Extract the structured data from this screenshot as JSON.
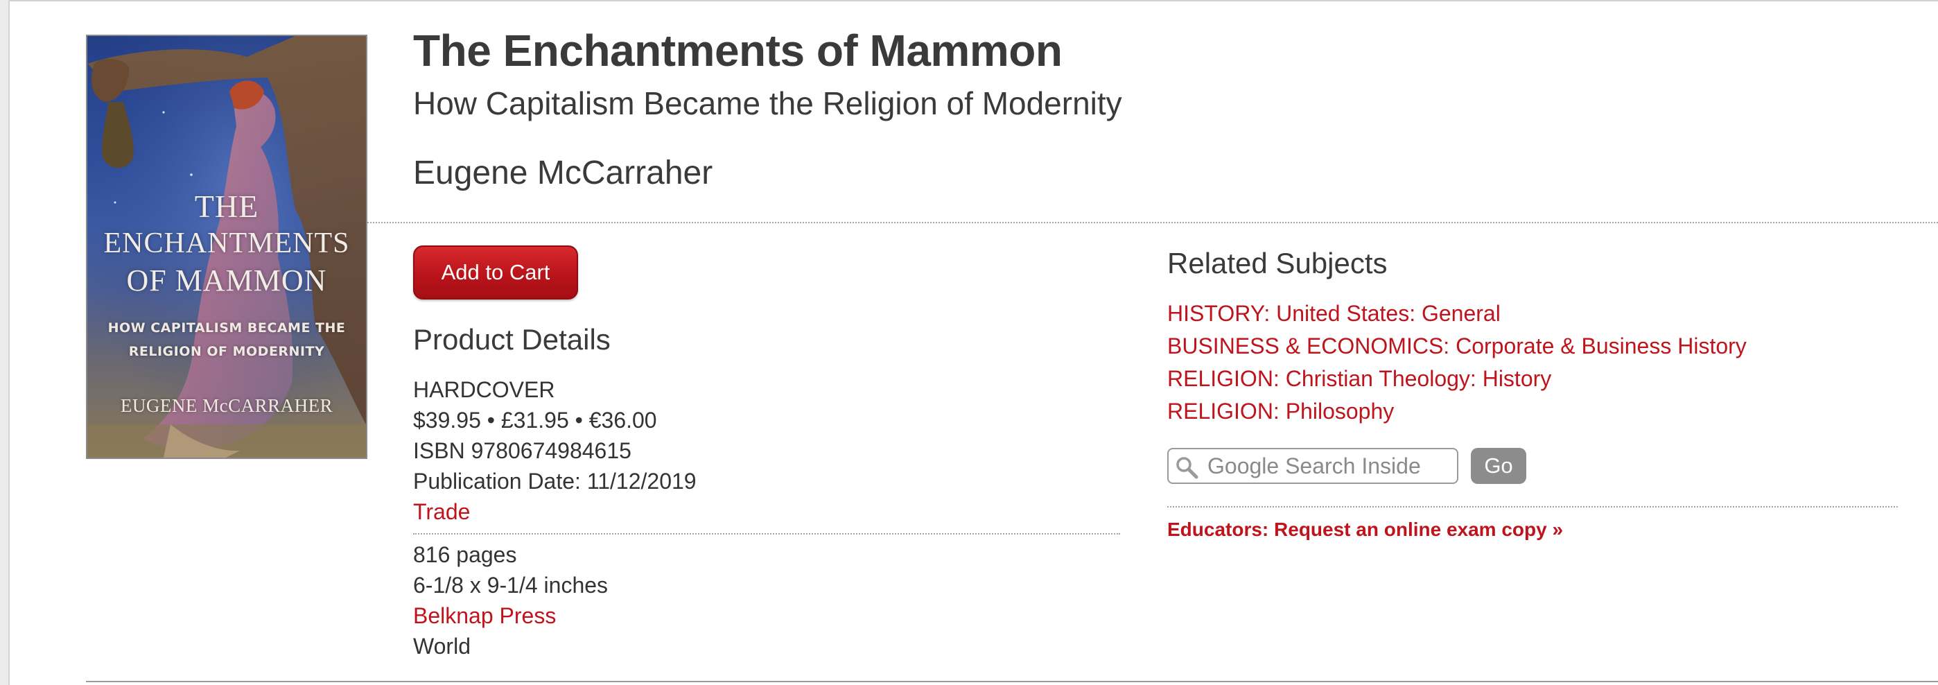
{
  "book": {
    "title": "The Enchantments of Mammon",
    "subtitle": "How Capitalism Became the Religion of Modernity",
    "author": "Eugene McCarraher"
  },
  "cover": {
    "title_line1": "THE",
    "title_line2": "ENCHANTMENTS",
    "title_line3": "OF MAMMON",
    "subtitle_line1": "HOW CAPITALISM BECAME THE",
    "subtitle_line2": "RELIGION OF MODERNITY",
    "author": "EUGENE McCARRAHER"
  },
  "actions": {
    "add_to_cart": "Add to Cart"
  },
  "product_details": {
    "heading": "Product Details",
    "format": "HARDCOVER",
    "price": "$39.95 • £31.95 • €36.00",
    "isbn": "ISBN 9780674984615",
    "publication_date": "Publication Date: 11/12/2019",
    "category": "Trade",
    "pages": "816 pages",
    "dimensions": "6-1/8 x 9-1/4 inches",
    "publisher": "Belknap Press",
    "territory": "World"
  },
  "related_subjects": {
    "heading": "Related Subjects",
    "items": [
      "HISTORY: United States: General",
      "BUSINESS & ECONOMICS: Corporate & Business History",
      "RELIGION: Christian Theology: History",
      "RELIGION: Philosophy"
    ]
  },
  "search": {
    "placeholder": "Google Search Inside",
    "go_label": "Go"
  },
  "educators": {
    "link_text": "Educators: Request an online exam copy »"
  },
  "colors": {
    "link_red": "#c0141c",
    "button_red": "#b9141a",
    "text_dark": "#3a3a3a",
    "go_gray": "#8c8c8c"
  }
}
